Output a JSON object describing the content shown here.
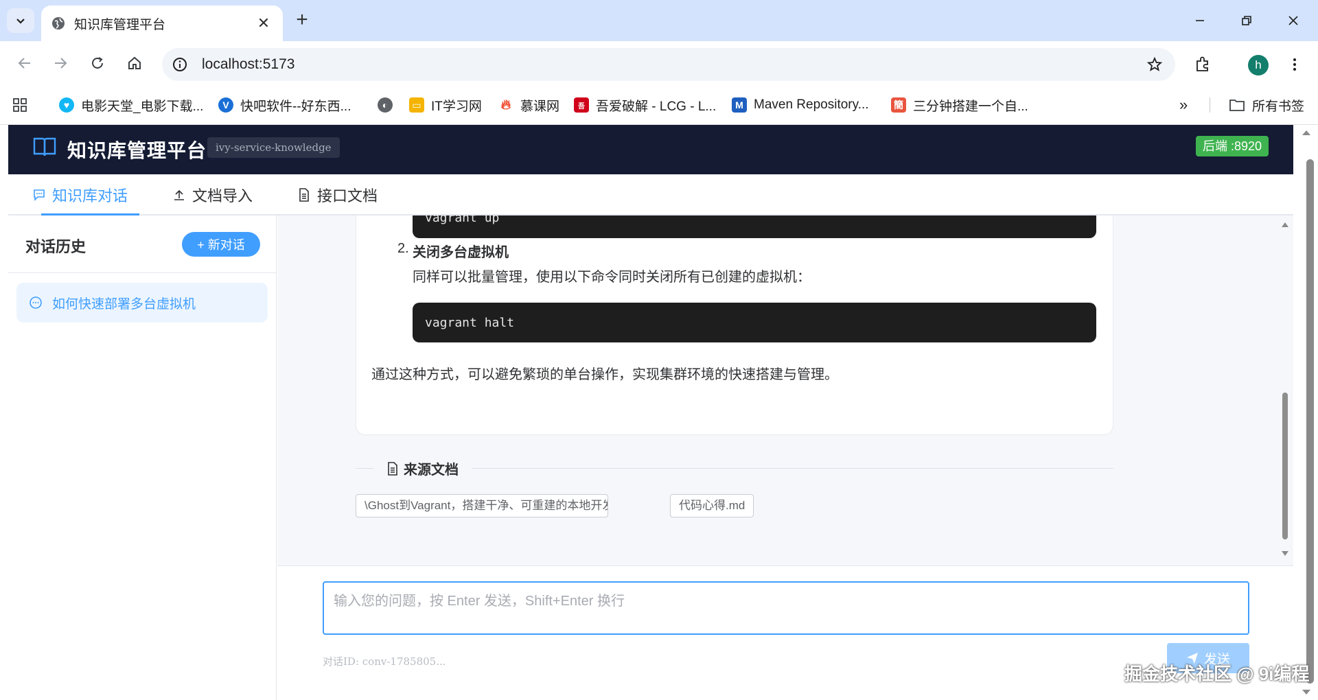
{
  "browser": {
    "tab_title": "知识库管理平台",
    "url": "localhost:5173",
    "avatar_letter": "h",
    "bookmarks": [
      {
        "label": "电影天堂_电影下载...",
        "color": "#12b7f5"
      },
      {
        "label": "快吧软件--好东西...",
        "color": "#1a6fd6"
      },
      {
        "label": "",
        "color": "#555555"
      },
      {
        "label": "IT学习网",
        "color": "#f4b400"
      },
      {
        "label": "慕课网",
        "color": "#f04e30"
      },
      {
        "label": "吾爱破解 - LCG - L...",
        "color": "#d0021b"
      },
      {
        "label": "Maven Repository...",
        "color": "#1f5fbf"
      },
      {
        "label": "三分钟搭建一个自...",
        "color": "#e8543e"
      }
    ],
    "all_bookmarks": "所有书签"
  },
  "app": {
    "title": "知识库管理平台",
    "service_tag": "ivy-service-knowledge",
    "backend_tag": "后端 :8920",
    "tabs": [
      {
        "label": "知识库对话",
        "active": true
      },
      {
        "label": "文档导入",
        "active": false
      },
      {
        "label": "接口文档",
        "active": false
      }
    ]
  },
  "sidebar": {
    "title": "对话历史",
    "new_chat": "+ 新对话",
    "conversations": [
      {
        "label": "如何快速部署多台虚拟机"
      }
    ]
  },
  "message": {
    "code_top": "vagrant up",
    "item_number": "2.",
    "item_title": "关闭多台虚拟机",
    "item_desc": "同样可以批量管理，使用以下命令同时关闭所有已创建的虚拟机：",
    "code_halt": "vagrant halt",
    "summary": "通过这种方式，可以避免繁琐的单台操作，实现集群环境的快速搭建与管理。"
  },
  "sources": {
    "label": "来源文档",
    "docs": [
      "\\Ghost到Vagrant，搭建干净、可重建的本地开发环境.m",
      "代码心得.md"
    ]
  },
  "input": {
    "placeholder": "输入您的问题，按 Enter 发送，Shift+Enter 换行",
    "conversation_id": "对话ID: conv-1785805...",
    "send_label": "发送"
  },
  "watermark": "掘金技术社区 @ 9i编程"
}
